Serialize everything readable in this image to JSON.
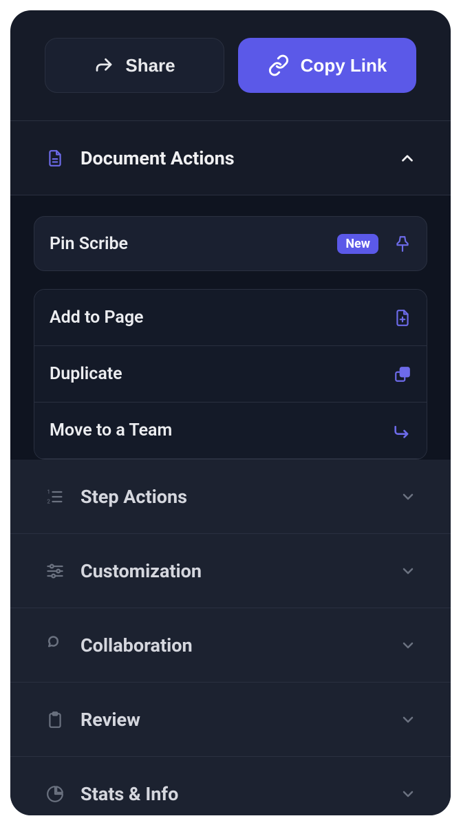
{
  "buttons": {
    "share": "Share",
    "copy_link": "Copy Link"
  },
  "sections": {
    "document_actions": {
      "title": "Document Actions",
      "items": {
        "pin": {
          "label": "Pin Scribe",
          "badge": "New"
        },
        "add_to_page": "Add to Page",
        "duplicate": "Duplicate",
        "move_team": "Move to a Team"
      }
    },
    "step_actions": {
      "title": "Step Actions"
    },
    "customization": {
      "title": "Customization"
    },
    "collaboration": {
      "title": "Collaboration"
    },
    "review": {
      "title": "Review"
    },
    "stats_info": {
      "title": "Stats & Info"
    }
  }
}
